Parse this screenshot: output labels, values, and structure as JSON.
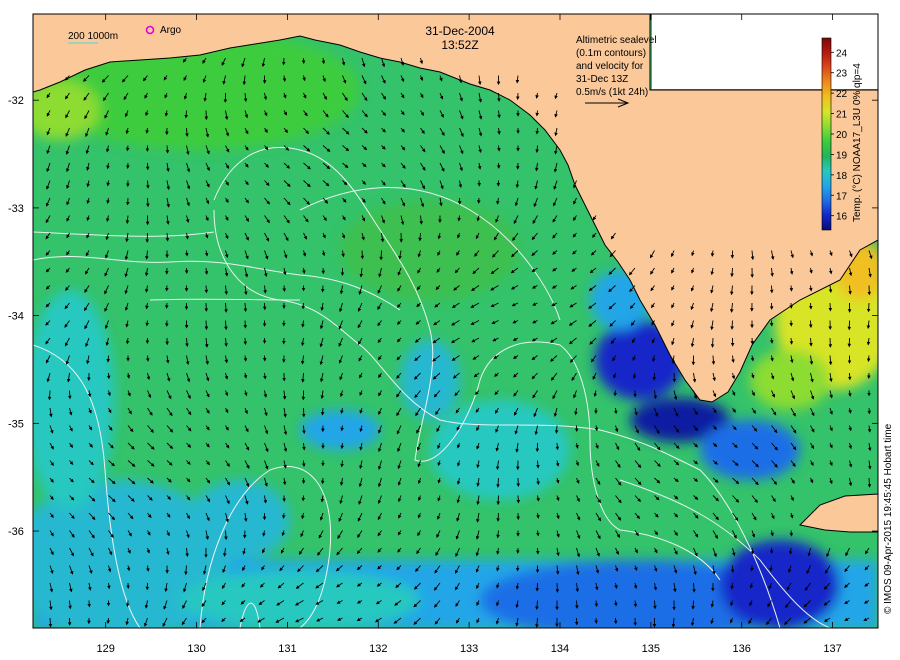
{
  "title": {
    "date": "31-Dec-2004",
    "time": "13:52Z"
  },
  "legend": {
    "depth_label": "200  1000m",
    "argo_label": "Argo",
    "altimetry_lines": [
      "Altimetric sealevel",
      "(0.1m contours)",
      "and velocity for",
      "31-Dec 13Z",
      "0.5m/s (1kt 24h)"
    ]
  },
  "colorbar": {
    "label": "Temp. (°C) NOAA17_L3U 0% qlp=4",
    "ticks": [
      "16",
      "17",
      "18",
      "19",
      "20",
      "21",
      "22",
      "23",
      "24"
    ],
    "min": 15.3,
    "max": 24.7,
    "colors": [
      "#080a7a",
      "#1228c8",
      "#1e6ee6",
      "#22a6e8",
      "#26c8c0",
      "#22b45a",
      "#3ccc3c",
      "#8cdc32",
      "#d8e428",
      "#f0c020",
      "#ee8a20",
      "#dc4a1c",
      "#b41a12",
      "#7a0a08"
    ]
  },
  "axes": {
    "x_ticks": [
      "129",
      "130",
      "131",
      "132",
      "133",
      "134",
      "135",
      "136",
      "137"
    ],
    "y_ticks": [
      "-32",
      "-33",
      "-34",
      "-35",
      "-36"
    ],
    "x_range": [
      128.2,
      137.5
    ],
    "y_range": [
      -36.9,
      -31.2
    ]
  },
  "credit": "© IMOS 09-Apr-2015 19:45:45 Hobart time",
  "colors": {
    "land": "#fbc89a",
    "ocean_base": "#34c26a",
    "coast": "#000000"
  }
}
